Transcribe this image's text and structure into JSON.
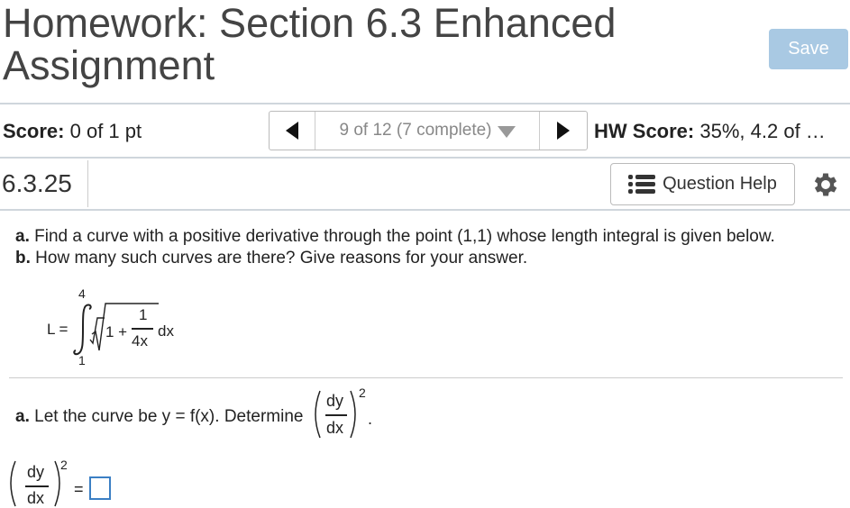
{
  "header": {
    "title": "Homework: Section 6.3 Enhanced Assignment",
    "save_label": "Save"
  },
  "scorebar": {
    "score_label": "Score:",
    "score_value": "0 of 1 pt",
    "nav_status": "9 of 12 (7 complete)",
    "hw_score_label": "HW Score:",
    "hw_score_value": "35%, 4.2 of …"
  },
  "question_bar": {
    "number": "6.3.25",
    "help_label": "Question Help"
  },
  "question": {
    "part_a_label": "a.",
    "part_a_text": "Find a curve with a positive derivative through the point (1,1) whose length integral is given below.",
    "part_b_label": "b.",
    "part_b_text": "How many such curves are there? Give reasons for your answer.",
    "integral": {
      "lhs": "L =",
      "upper": "4",
      "lower": "1",
      "one_plus": "1 +",
      "numerator": "1",
      "denominator": "4x",
      "dx": "dx"
    }
  },
  "subquestion": {
    "label": "a.",
    "text": "Let the curve be y = f(x). Determine",
    "numerator": "dy",
    "denominator": "dx",
    "exponent": "2",
    "period": ".",
    "answer_lhs_num": "dy",
    "answer_lhs_den": "dx",
    "answer_exp": "2",
    "equals": "="
  },
  "icons": {
    "prev": "left-triangle-icon",
    "next": "right-triangle-icon",
    "dropdown": "chevron-down-icon",
    "help": "list-icon",
    "settings": "gear-icon"
  },
  "colors": {
    "save_button": "#a9c9e3",
    "answer_box_border": "#3b7fc4"
  }
}
